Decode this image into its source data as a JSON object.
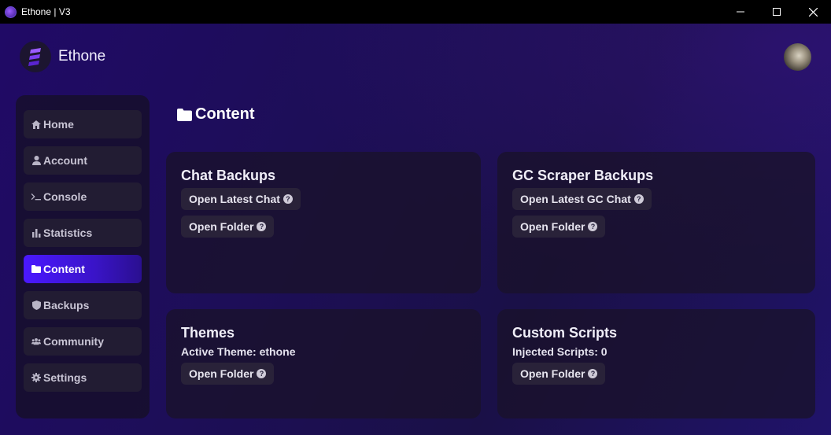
{
  "window": {
    "title": "Ethone | V3"
  },
  "brand": {
    "name": "Ethone"
  },
  "sidebar": {
    "items": [
      {
        "label": "Home",
        "icon": "home-icon",
        "active": false
      },
      {
        "label": "Account",
        "icon": "user-icon",
        "active": false
      },
      {
        "label": "Console",
        "icon": "terminal-icon",
        "active": false
      },
      {
        "label": "Statistics",
        "icon": "bar-chart-icon",
        "active": false
      },
      {
        "label": "Content",
        "icon": "folder-icon",
        "active": true
      },
      {
        "label": "Backups",
        "icon": "shield-icon",
        "active": false
      },
      {
        "label": "Community",
        "icon": "users-icon",
        "active": false
      },
      {
        "label": "Settings",
        "icon": "gear-icon",
        "active": false
      }
    ]
  },
  "page": {
    "title": "Content"
  },
  "cards": {
    "chat_backups": {
      "title": "Chat Backups",
      "btn_latest": "Open Latest Chat",
      "btn_folder": "Open Folder"
    },
    "gc_scraper": {
      "title": "GC Scraper Backups",
      "btn_latest": "Open Latest GC Chat",
      "btn_folder": "Open Folder"
    },
    "themes": {
      "title": "Themes",
      "subtitle": "Active Theme: ethone",
      "btn_folder": "Open Folder"
    },
    "custom_scripts": {
      "title": "Custom Scripts",
      "subtitle": "Injected Scripts: 0",
      "btn_folder": "Open Folder"
    }
  },
  "colors": {
    "accent": "#4a18ff",
    "background": "#1a0d4a",
    "card": "#19122a"
  }
}
